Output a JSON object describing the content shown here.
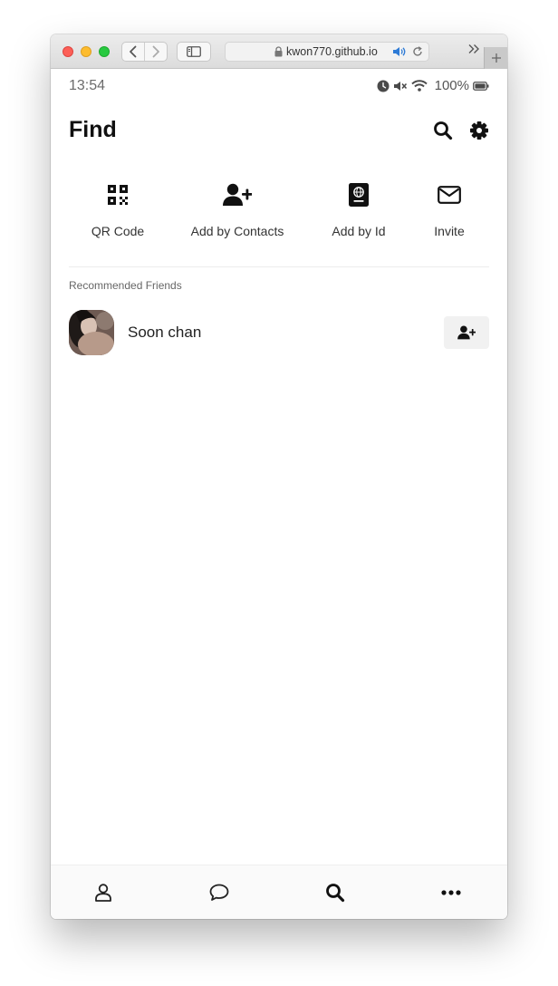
{
  "browser": {
    "url": "kwon770.github.io"
  },
  "status_bar": {
    "time": "13:54",
    "battery": "100%"
  },
  "header": {
    "title": "Find"
  },
  "actions": [
    {
      "label": "QR Code",
      "icon": "qr-code-icon"
    },
    {
      "label": "Add by Contacts",
      "icon": "user-plus-icon"
    },
    {
      "label": "Add by Id",
      "icon": "passport-icon"
    },
    {
      "label": "Invite",
      "icon": "envelope-icon"
    }
  ],
  "recommended": {
    "title": "Recommended Friends",
    "friends": [
      {
        "name": "Soon chan"
      }
    ]
  },
  "bottom_nav": [
    {
      "icon": "user-icon"
    },
    {
      "icon": "chat-bubble-icon"
    },
    {
      "icon": "search-icon"
    },
    {
      "icon": "more-icon"
    }
  ],
  "colors": {
    "text_primary": "#111111",
    "icon": "#111111",
    "divider": "#ececec",
    "nav_background": "#fafafa",
    "add_button_background": "#f1f1f1"
  }
}
